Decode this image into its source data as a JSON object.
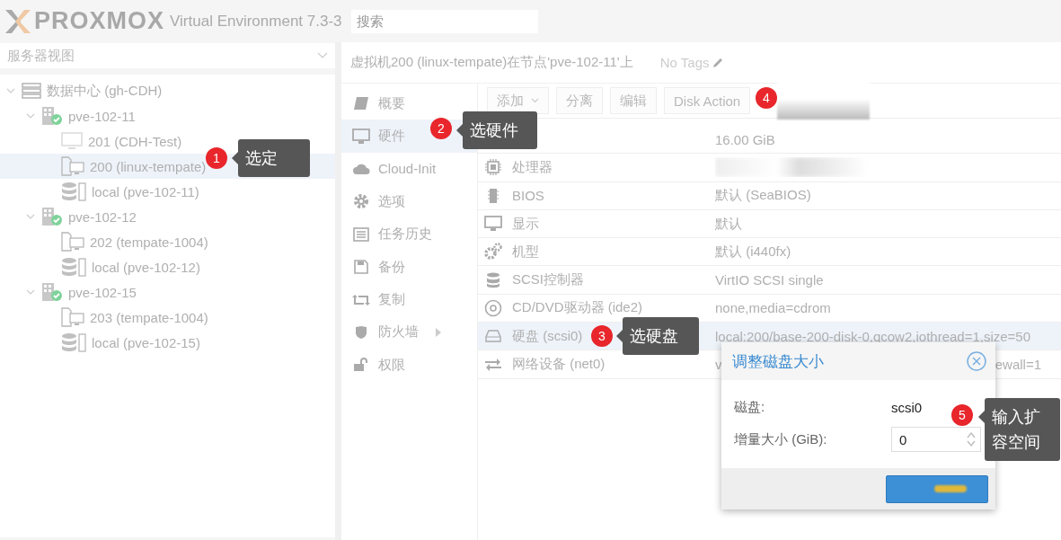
{
  "header": {
    "logo": "PROXMOX",
    "product": "Virtual Environment 7.3-3",
    "search": {
      "placeholder": "搜索"
    }
  },
  "sidebar": {
    "view_selector": "服务器视图",
    "tree": [
      {
        "label": "数据中心 (gh-CDH)",
        "kind": "datacenter",
        "selected": false,
        "expanded": true,
        "children": [
          {
            "label": "pve-102-11",
            "kind": "node",
            "selected": false,
            "expanded": true,
            "children": [
              {
                "label": "201 (CDH-Test)",
                "kind": "vm",
                "selected": false
              },
              {
                "label": "200 (linux-tempate)",
                "kind": "template",
                "selected": true
              },
              {
                "label": "local (pve-102-11)",
                "kind": "storage",
                "selected": false
              }
            ]
          },
          {
            "label": "pve-102-12",
            "kind": "node",
            "selected": false,
            "expanded": true,
            "children": [
              {
                "label": "202 (tempate-1004)",
                "kind": "template",
                "selected": false
              },
              {
                "label": "local (pve-102-12)",
                "kind": "storage",
                "selected": false
              }
            ]
          },
          {
            "label": "pve-102-15",
            "kind": "node",
            "selected": false,
            "expanded": true,
            "children": [
              {
                "label": "203 (tempate-1004)",
                "kind": "template",
                "selected": false
              },
              {
                "label": "local (pve-102-15)",
                "kind": "storage",
                "selected": false
              }
            ]
          }
        ]
      }
    ]
  },
  "vm_title": "虚拟机200 (linux-tempate)在节点'pve-102-11'上",
  "tags": "No Tags",
  "nav": [
    {
      "label": "概要",
      "kind": "summary",
      "selected": false,
      "submenu": false
    },
    {
      "label": "硬件",
      "kind": "hardware",
      "selected": true,
      "submenu": false
    },
    {
      "label": "Cloud-Init",
      "kind": "cloud",
      "selected": false,
      "submenu": false
    },
    {
      "label": "选项",
      "kind": "options",
      "selected": false,
      "submenu": false
    },
    {
      "label": "任务历史",
      "kind": "tasks",
      "selected": false,
      "submenu": false
    },
    {
      "label": "备份",
      "kind": "backup",
      "selected": false,
      "submenu": false
    },
    {
      "label": "复制",
      "kind": "replication",
      "selected": false,
      "submenu": false
    },
    {
      "label": "防火墙",
      "kind": "firewall",
      "selected": false,
      "submenu": true
    },
    {
      "label": "权限",
      "kind": "permissions",
      "selected": false,
      "submenu": false
    }
  ],
  "toolbar": [
    {
      "label": "添加",
      "kind": "dropdown"
    },
    {
      "label": "分离",
      "kind": "button"
    },
    {
      "label": "编辑",
      "kind": "button"
    },
    {
      "label": "Disk Action",
      "kind": "button"
    }
  ],
  "hardware": [
    {
      "kind": "memory",
      "value": "16.00 GiB",
      "selected": false
    },
    {
      "kind": "cpu",
      "label": "处理器",
      "selected": false
    },
    {
      "kind": "bios",
      "label": "BIOS",
      "value": "默认 (SeaBIOS)",
      "selected": false
    },
    {
      "kind": "display",
      "label": "显示",
      "value": "默认",
      "selected": false
    },
    {
      "kind": "machine",
      "label": "机型",
      "value": "默认 (i440fx)",
      "selected": false
    },
    {
      "kind": "scsi",
      "label": "SCSI控制器",
      "value": "VirtIO SCSI single",
      "selected": false
    },
    {
      "kind": "cdrom",
      "label": "CD/DVD驱动器 (ide2)",
      "value": "none,media=cdrom",
      "selected": false
    },
    {
      "kind": "disk",
      "label": "硬盘 (scsi0)",
      "value": "local:200/base-200-disk-0,qcow2,iothread=1,size=50",
      "selected": true
    },
    {
      "kind": "network",
      "label": "网络设备 (net0)",
      "value": "v",
      "value_tail": "ewall=1",
      "selected": false
    }
  ],
  "dialog": {
    "title": "调整磁盘大小",
    "fields": [
      {
        "label": "磁盘:",
        "kind": "text",
        "value": "scsi0"
      },
      {
        "label": "增量大小 (GiB):",
        "kind": "spinner",
        "value": "0"
      }
    ]
  },
  "callouts": [
    {
      "number": "1",
      "text": "选定"
    },
    {
      "number": "2",
      "text": "选硬件"
    },
    {
      "number": "3",
      "text": "选硬盘"
    },
    {
      "number": "4"
    },
    {
      "number": "5",
      "text": "输入扩容空间"
    }
  ]
}
